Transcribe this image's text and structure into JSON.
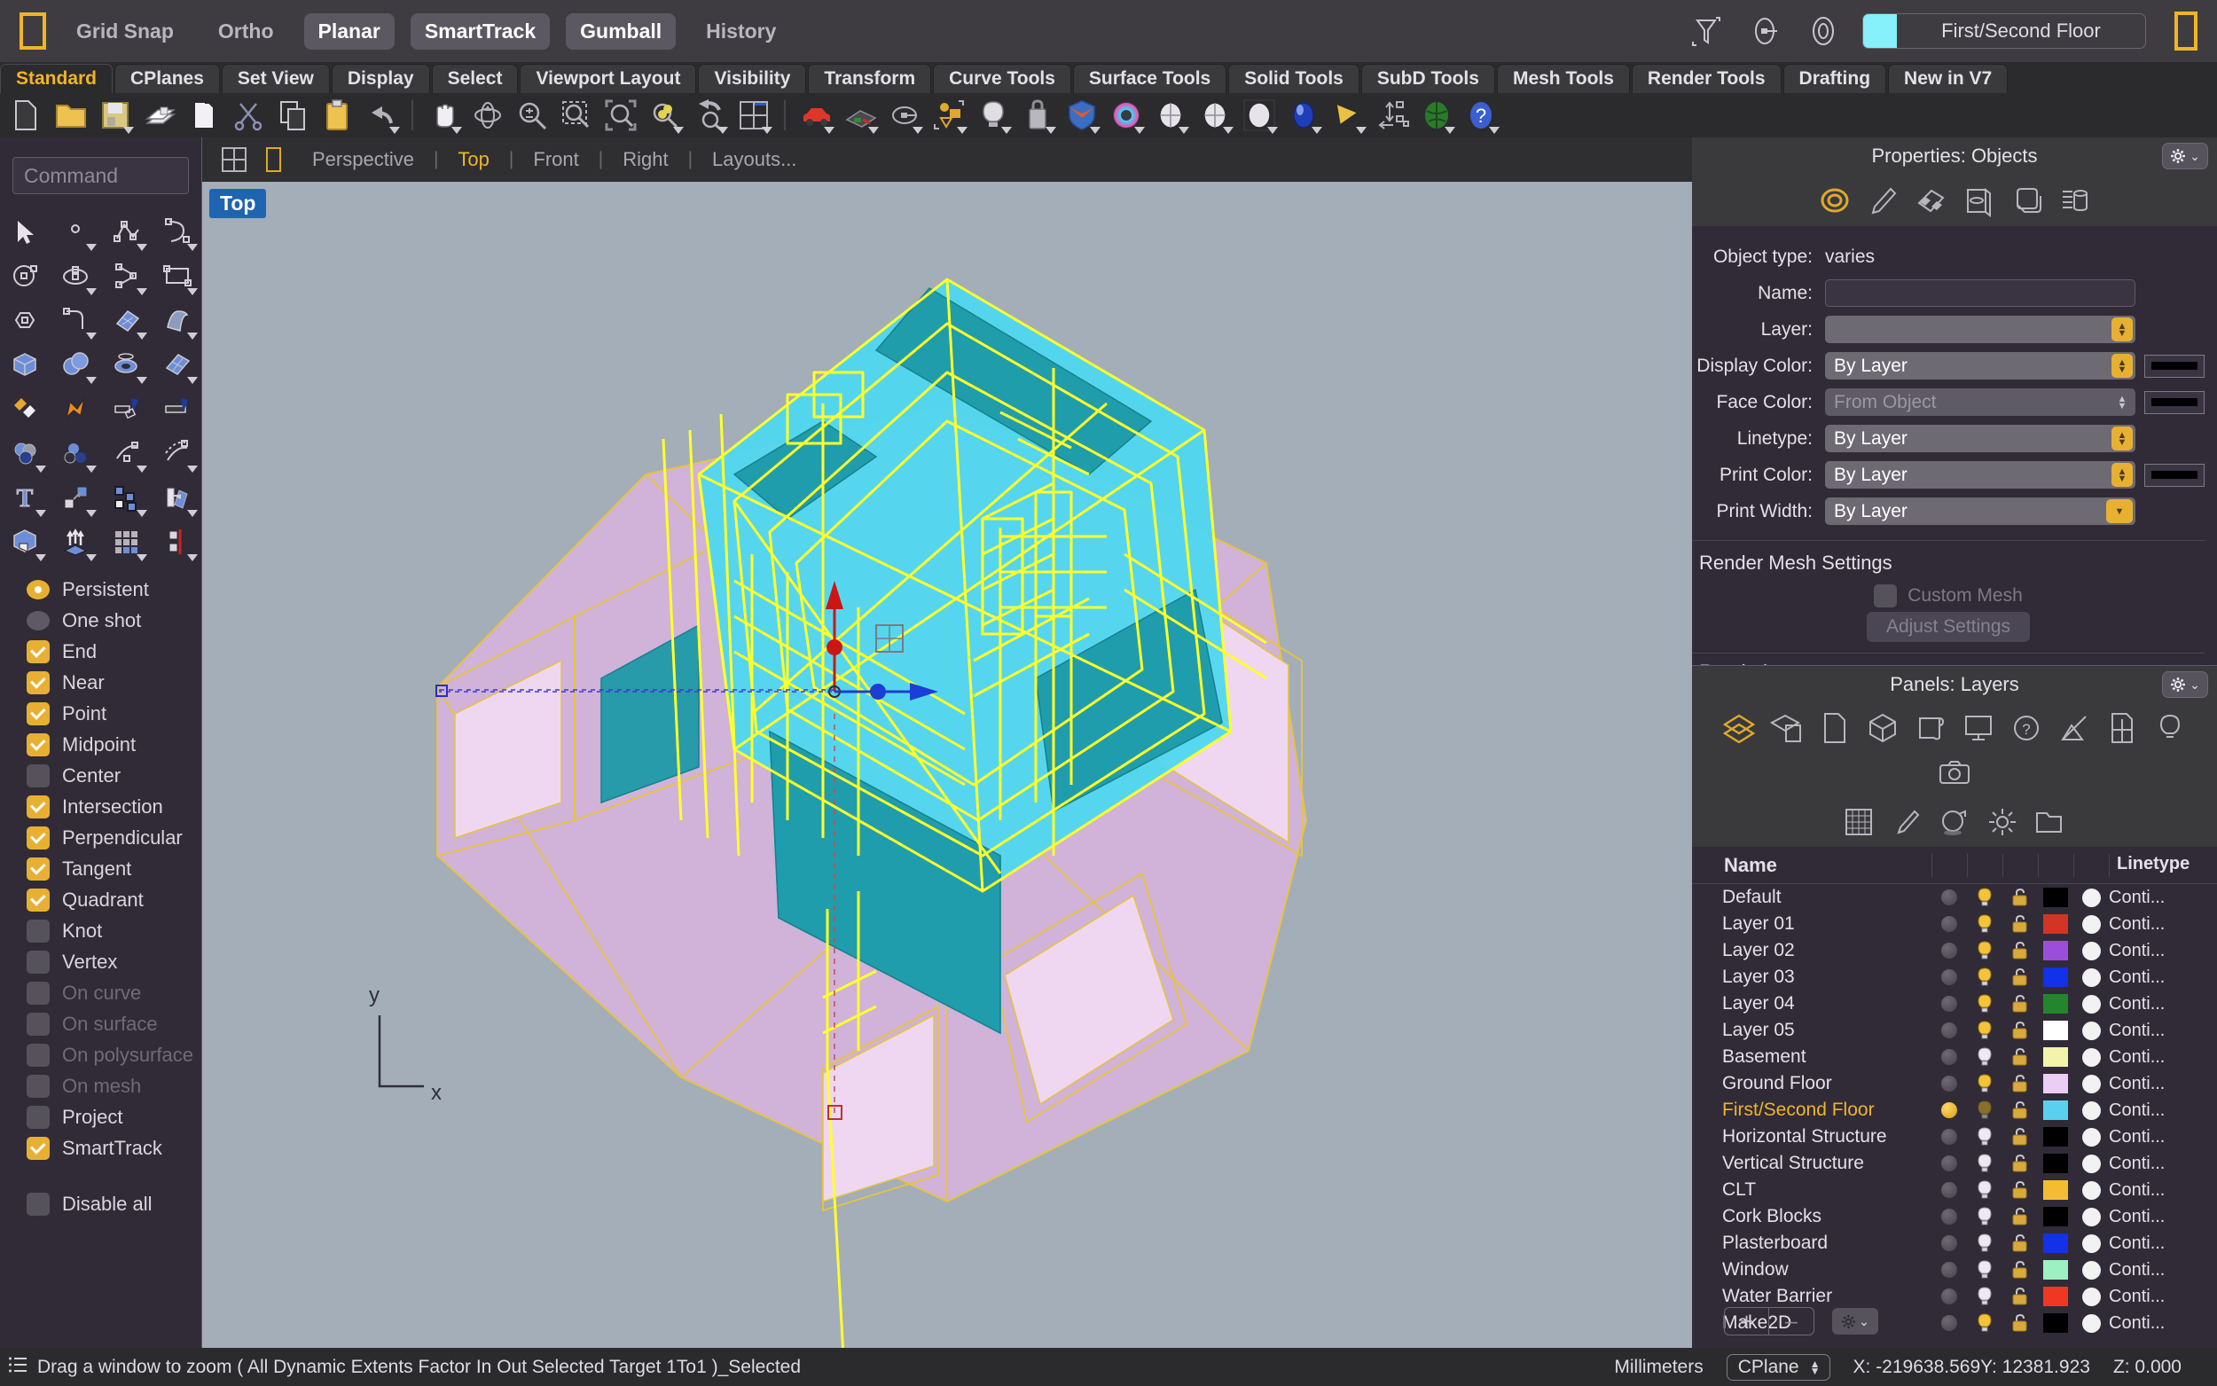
{
  "topbar": {
    "logo_icon": "rhino-logo-icon",
    "toggles": [
      {
        "label": "Grid Snap",
        "active": false
      },
      {
        "label": "Ortho",
        "active": false
      },
      {
        "label": "Planar",
        "active": true
      },
      {
        "label": "SmartTrack",
        "active": true
      },
      {
        "label": "Gumball",
        "active": true
      },
      {
        "label": "History",
        "active": false
      }
    ],
    "icons": [
      "filter-icon",
      "named-view-icon",
      "target-icon"
    ],
    "current_layer": {
      "name": "First/Second Floor",
      "color": "#86f0fb"
    }
  },
  "tabs": [
    {
      "label": "Standard",
      "selected": true
    },
    {
      "label": "CPlanes",
      "selected": false
    },
    {
      "label": "Set View",
      "selected": false
    },
    {
      "label": "Display",
      "selected": false
    },
    {
      "label": "Select",
      "selected": false
    },
    {
      "label": "Viewport Layout",
      "selected": false
    },
    {
      "label": "Visibility",
      "selected": false
    },
    {
      "label": "Transform",
      "selected": false
    },
    {
      "label": "Curve Tools",
      "selected": false
    },
    {
      "label": "Surface Tools",
      "selected": false
    },
    {
      "label": "Solid Tools",
      "selected": false
    },
    {
      "label": "SubD Tools",
      "selected": false
    },
    {
      "label": "Mesh Tools",
      "selected": false
    },
    {
      "label": "Render Tools",
      "selected": false
    },
    {
      "label": "Drafting",
      "selected": false
    },
    {
      "label": "New in V7",
      "selected": false
    }
  ],
  "main_toolbar": [
    {
      "name": "new-file-icon"
    },
    {
      "name": "open-file-icon"
    },
    {
      "name": "save-file-icon"
    },
    {
      "name": "print-icon"
    },
    {
      "name": "cut-page-icon"
    },
    {
      "name": "scissors-cut-icon"
    },
    {
      "name": "copy-icon"
    },
    {
      "name": "paste-icon"
    },
    {
      "name": "undo-icon"
    },
    {
      "name": "pan-hand-icon"
    },
    {
      "name": "rotate-view-icon"
    },
    {
      "name": "zoom-icon"
    },
    {
      "name": "zoom-window-icon"
    },
    {
      "name": "zoom-extents-icon"
    },
    {
      "name": "zoom-selected-icon"
    },
    {
      "name": "undo-view-icon"
    },
    {
      "name": "four-view-icon"
    },
    {
      "name": "render-car-icon"
    },
    {
      "name": "shaded-car-icon"
    },
    {
      "name": "grid-plane-icon"
    },
    {
      "name": "named-cplane-icon"
    },
    {
      "name": "layer-state-icon"
    },
    {
      "name": "light-bulb-icon"
    },
    {
      "name": "lock-icon"
    },
    {
      "name": "surface-shield-icon"
    },
    {
      "name": "color-wheel-icon"
    },
    {
      "name": "sphere-shade-icon"
    },
    {
      "name": "sphere-grid-icon"
    },
    {
      "name": "blue-sphere-icon"
    },
    {
      "name": "spot-cone-icon"
    },
    {
      "name": "dimension-icon"
    },
    {
      "name": "render-globe-icon"
    },
    {
      "name": "help-icon"
    }
  ],
  "command": {
    "placeholder": "Command",
    "value": ""
  },
  "left_tools": [
    "select-arrow-icon",
    "point-icon",
    "polyline-icon",
    "curve-icon",
    "circle-icon",
    "ellipse-icon",
    "arc-icon",
    "rectangle-icon",
    "polygon-icon",
    "fillet-curve-icon",
    "surface-from-curves-icon",
    "extrude-surface-icon",
    "box-icon",
    "sphere-boolean-icon",
    "torus-icon",
    "surface-patch-icon",
    "boolean-union-icon",
    "explode-icon",
    "trim-icon",
    "split-icon",
    "boolean-three-icon",
    "boolean-two-icon",
    "offset-curve-icon",
    "offset-dashed-icon",
    "text-icon",
    "scale-icon",
    "array-icon",
    "mirror-icon",
    "solid-tools-icon",
    "extrude-arrows-icon",
    "grid-array-icon",
    "section-icon"
  ],
  "osnap": {
    "mode_items": [
      {
        "label": "Persistent",
        "type": "radio",
        "checked": true,
        "disabled": false
      },
      {
        "label": "One shot",
        "type": "radio",
        "checked": false,
        "disabled": false
      }
    ],
    "items": [
      {
        "label": "End",
        "checked": true,
        "disabled": false
      },
      {
        "label": "Near",
        "checked": true,
        "disabled": false
      },
      {
        "label": "Point",
        "checked": true,
        "disabled": false
      },
      {
        "label": "Midpoint",
        "checked": true,
        "disabled": false
      },
      {
        "label": "Center",
        "checked": false,
        "disabled": false
      },
      {
        "label": "Intersection",
        "checked": true,
        "disabled": false
      },
      {
        "label": "Perpendicular",
        "checked": true,
        "disabled": false
      },
      {
        "label": "Tangent",
        "checked": true,
        "disabled": false
      },
      {
        "label": "Quadrant",
        "checked": true,
        "disabled": false
      },
      {
        "label": "Knot",
        "checked": false,
        "disabled": false
      },
      {
        "label": "Vertex",
        "checked": false,
        "disabled": false
      },
      {
        "label": "On curve",
        "checked": false,
        "disabled": true
      },
      {
        "label": "On surface",
        "checked": false,
        "disabled": true
      },
      {
        "label": "On polysurface",
        "checked": false,
        "disabled": true
      },
      {
        "label": "On mesh",
        "checked": false,
        "disabled": true
      },
      {
        "label": "Project",
        "checked": false,
        "disabled": false
      },
      {
        "label": "SmartTrack",
        "checked": true,
        "disabled": false
      }
    ],
    "disable_all": {
      "label": "Disable all",
      "checked": false
    }
  },
  "viewport": {
    "layout_icons": [
      "four-view-layout-icon",
      "single-view-layout-icon"
    ],
    "views": [
      {
        "label": "Perspective",
        "selected": false
      },
      {
        "label": "Top",
        "selected": true
      },
      {
        "label": "Front",
        "selected": false
      },
      {
        "label": "Right",
        "selected": false
      },
      {
        "label": "Layouts...",
        "selected": false
      }
    ],
    "active_label": "Top",
    "axis_labels": {
      "y": "y",
      "x": "x"
    }
  },
  "properties": {
    "title": "Properties: Objects",
    "tab_icons": [
      "object-properties-icon",
      "material-icon",
      "texture-mapping-icon",
      "display-icon",
      "object-icon",
      "list-icon"
    ],
    "object_type_label": "Object type:",
    "object_type_value": "varies",
    "fields": [
      {
        "label": "Name:",
        "value": "",
        "style": "empty",
        "swatch": false,
        "spinner": false
      },
      {
        "label": "Layer:",
        "value": "",
        "style": "solid",
        "swatch": false,
        "spinner": true
      },
      {
        "label": "Display Color:",
        "value": "By Layer",
        "style": "solid",
        "swatch": true,
        "spinner": true
      },
      {
        "label": "Face Color:",
        "value": "From Object",
        "style": "greyed",
        "swatch": true,
        "spinner": "grey"
      },
      {
        "label": "Linetype:",
        "value": "By Layer",
        "style": "solid",
        "swatch": false,
        "spinner": true
      },
      {
        "label": "Print Color:",
        "value": "By Layer",
        "style": "solid",
        "swatch": true,
        "spinner": true
      },
      {
        "label": "Print Width:",
        "value": "By Layer",
        "style": "solid",
        "swatch": false,
        "spinner": "wide"
      }
    ],
    "render_mesh_heading": "Render Mesh Settings",
    "custom_mesh_label": "Custom Mesh",
    "adjust_settings_label": "Adjust Settings",
    "rendering_heading": "Rendering"
  },
  "layers_panel": {
    "title": "Panels: Layers",
    "tab_icons_row1": [
      "layers-icon",
      "layer-material-icon",
      "page-icon",
      "cube-icon",
      "scroll-icon",
      "display-monitor-icon",
      "help-question-icon",
      "tools-hammer-icon",
      "window-icon",
      "light-bulb-icon",
      "camera-icon"
    ],
    "tab_icons_row2": [
      "grid-icon",
      "material-brush-icon",
      "render-ball-icon",
      "sun-icon",
      "folder-icon"
    ],
    "columns": [
      "Name",
      "Linetype"
    ],
    "rows": [
      {
        "name": "Default",
        "selected": false,
        "on": false,
        "bulb": "on",
        "color": "#000000",
        "linetype": "Conti..."
      },
      {
        "name": "Layer 01",
        "selected": false,
        "on": false,
        "bulb": "on",
        "color": "#d33424",
        "linetype": "Conti..."
      },
      {
        "name": "Layer 02",
        "selected": false,
        "on": false,
        "bulb": "on",
        "color": "#9b4edb",
        "linetype": "Conti..."
      },
      {
        "name": "Layer 03",
        "selected": false,
        "on": false,
        "bulb": "on",
        "color": "#1331e8",
        "linetype": "Conti..."
      },
      {
        "name": "Layer 04",
        "selected": false,
        "on": false,
        "bulb": "on",
        "color": "#23862a",
        "linetype": "Conti..."
      },
      {
        "name": "Layer 05",
        "selected": false,
        "on": false,
        "bulb": "on",
        "color": "#ffffff",
        "linetype": "Conti..."
      },
      {
        "name": "Basement",
        "selected": false,
        "on": false,
        "bulb": "off",
        "color": "#f3f3ab",
        "linetype": "Conti..."
      },
      {
        "name": "Ground Floor",
        "selected": false,
        "on": false,
        "bulb": "on",
        "color": "#eccdf5",
        "linetype": "Conti..."
      },
      {
        "name": "First/Second Floor",
        "selected": true,
        "on": true,
        "bulb": "dim",
        "color": "#5ad0f0",
        "linetype": "Conti..."
      },
      {
        "name": "Horizontal Structure",
        "selected": false,
        "on": false,
        "bulb": "off",
        "color": "#000000",
        "linetype": "Conti..."
      },
      {
        "name": "Vertical Structure",
        "selected": false,
        "on": false,
        "bulb": "off",
        "color": "#000000",
        "linetype": "Conti..."
      },
      {
        "name": "CLT",
        "selected": false,
        "on": false,
        "bulb": "off",
        "color": "#f5bc32",
        "linetype": "Conti..."
      },
      {
        "name": "Cork Blocks",
        "selected": false,
        "on": false,
        "bulb": "off",
        "color": "#000000",
        "linetype": "Conti..."
      },
      {
        "name": "Plasterboard",
        "selected": false,
        "on": false,
        "bulb": "off",
        "color": "#1331e8",
        "linetype": "Conti..."
      },
      {
        "name": "Window",
        "selected": false,
        "on": false,
        "bulb": "off",
        "color": "#9cf0c2",
        "linetype": "Conti..."
      },
      {
        "name": "Water Barrier",
        "selected": false,
        "on": false,
        "bulb": "off",
        "color": "#ee3823",
        "linetype": "Conti..."
      },
      {
        "name": "Make2D",
        "selected": false,
        "on": false,
        "bulb": "on",
        "color": "#000000",
        "linetype": "Conti...",
        "expandable": true
      }
    ],
    "footer": {
      "add_label": "+",
      "remove_label": "–",
      "gear_icon": "gear-icon"
    }
  },
  "status": {
    "prompt_icon": "list-icon",
    "prompt": "Drag a window to zoom ( All Dynamic Extents Factor In Out Selected Target 1To1 )_Selected",
    "units": "Millimeters",
    "cplane": "CPlane",
    "coord_x": "X: -219638.569",
    "coord_y": "Y: 12381.923",
    "coord_z": "Z: 0.000"
  }
}
